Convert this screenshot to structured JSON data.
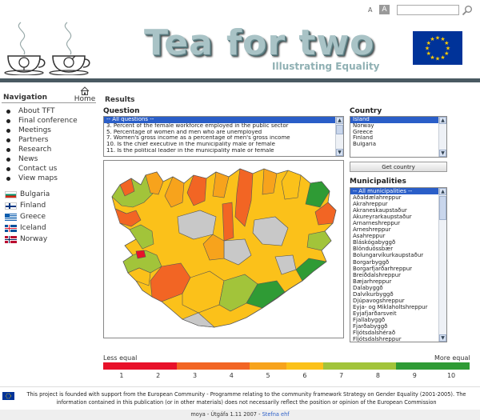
{
  "topbar": {
    "font_small": "A",
    "font_large": "A",
    "search_placeholder": ""
  },
  "header": {
    "title": "Tea for two",
    "subtitle": "Illustrating Equality"
  },
  "navigation": {
    "title": "Navigation",
    "home_label": "Home",
    "items": [
      "About TFT",
      "Final conference",
      "Meetings",
      "Partners",
      "Research",
      "News",
      "Contact us",
      "View maps"
    ],
    "countries": [
      {
        "label": "Bulgaria",
        "flag": "bulgaria-flag-icon"
      },
      {
        "label": "Finland",
        "flag": "finland-flag-icon"
      },
      {
        "label": "Greece",
        "flag": "greece-flag-icon"
      },
      {
        "label": "Iceland",
        "flag": "iceland-flag-icon"
      },
      {
        "label": "Norway",
        "flag": "norway-flag-icon"
      }
    ]
  },
  "results": {
    "title": "Results",
    "question_label": "Question",
    "questions": [
      "-- All questions --",
      "3. Percent of the female workforce employed in the public sector",
      "5. Percentage of women and men who are unemployed",
      "7. Women's gross income as a percentage of men's gross income",
      "10. Is the chief executive in the municipality male or female",
      "11. Is the political leader in the municipality male or female"
    ],
    "selected_question": 0
  },
  "country_panel": {
    "label": "Country",
    "options": [
      "Island",
      "Norway",
      "Greece",
      "Finland",
      "Bulgaria"
    ],
    "selected": 0,
    "button_label": "Get country"
  },
  "municipalities": {
    "label": "Municipalities",
    "items": [
      "-- All municipalities --",
      "Aðaldælahreppur",
      "Akrahreppur",
      "Akraneskaupstaður",
      "Akureyrarkaupstaður",
      "Arnarneshreppur",
      "Árneshreppur",
      "Ásahreppur",
      "Bláskógabyggð",
      "Blönduóssbær",
      "Bolungarvíkurkaupstaður",
      "Borgarbyggð",
      "Borgarfjarðarhreppur",
      "Breiðdalshreppur",
      "Bæjarhreppur",
      "Dalabyggð",
      "Dalvíkurbyggð",
      "Djúpavogshreppur",
      "Eyja- og Miklaholtshreppur",
      "Eyjafjarðarsveit",
      "Fjallabyggð",
      "Fjarðabyggð",
      "Fljótsdalshérað",
      "Fljótsdalshreppur"
    ],
    "selected": 0
  },
  "legend": {
    "less": "Less equal",
    "more": "More equal",
    "colors": [
      "#e8112a",
      "#e8112a",
      "#f26524",
      "#f26524",
      "#f7a31c",
      "#fbc11a",
      "#a2c43a",
      "#a2c43a",
      "#2f9b35",
      "#2f9b35"
    ],
    "numbers": [
      "1",
      "2",
      "3",
      "4",
      "5",
      "6",
      "7",
      "8",
      "9",
      "10"
    ]
  },
  "footer": {
    "text": "This project is founded with support from the European Community - Programme relating to the community framework Strategy on Gender Equality (2001-2005). The information contained in this publication (or in other materials) does not necessarily reflect the position or opinion of the European Commission",
    "bottom_prefix": "moya - Útgáfa 1.11 2007 - ",
    "bottom_link": "Stefna ehf"
  },
  "colors": {
    "header_rule": "#4a5a62",
    "selection": "#2a5ec8",
    "eu_blue": "#003399",
    "eu_gold": "#ffcc00"
  }
}
